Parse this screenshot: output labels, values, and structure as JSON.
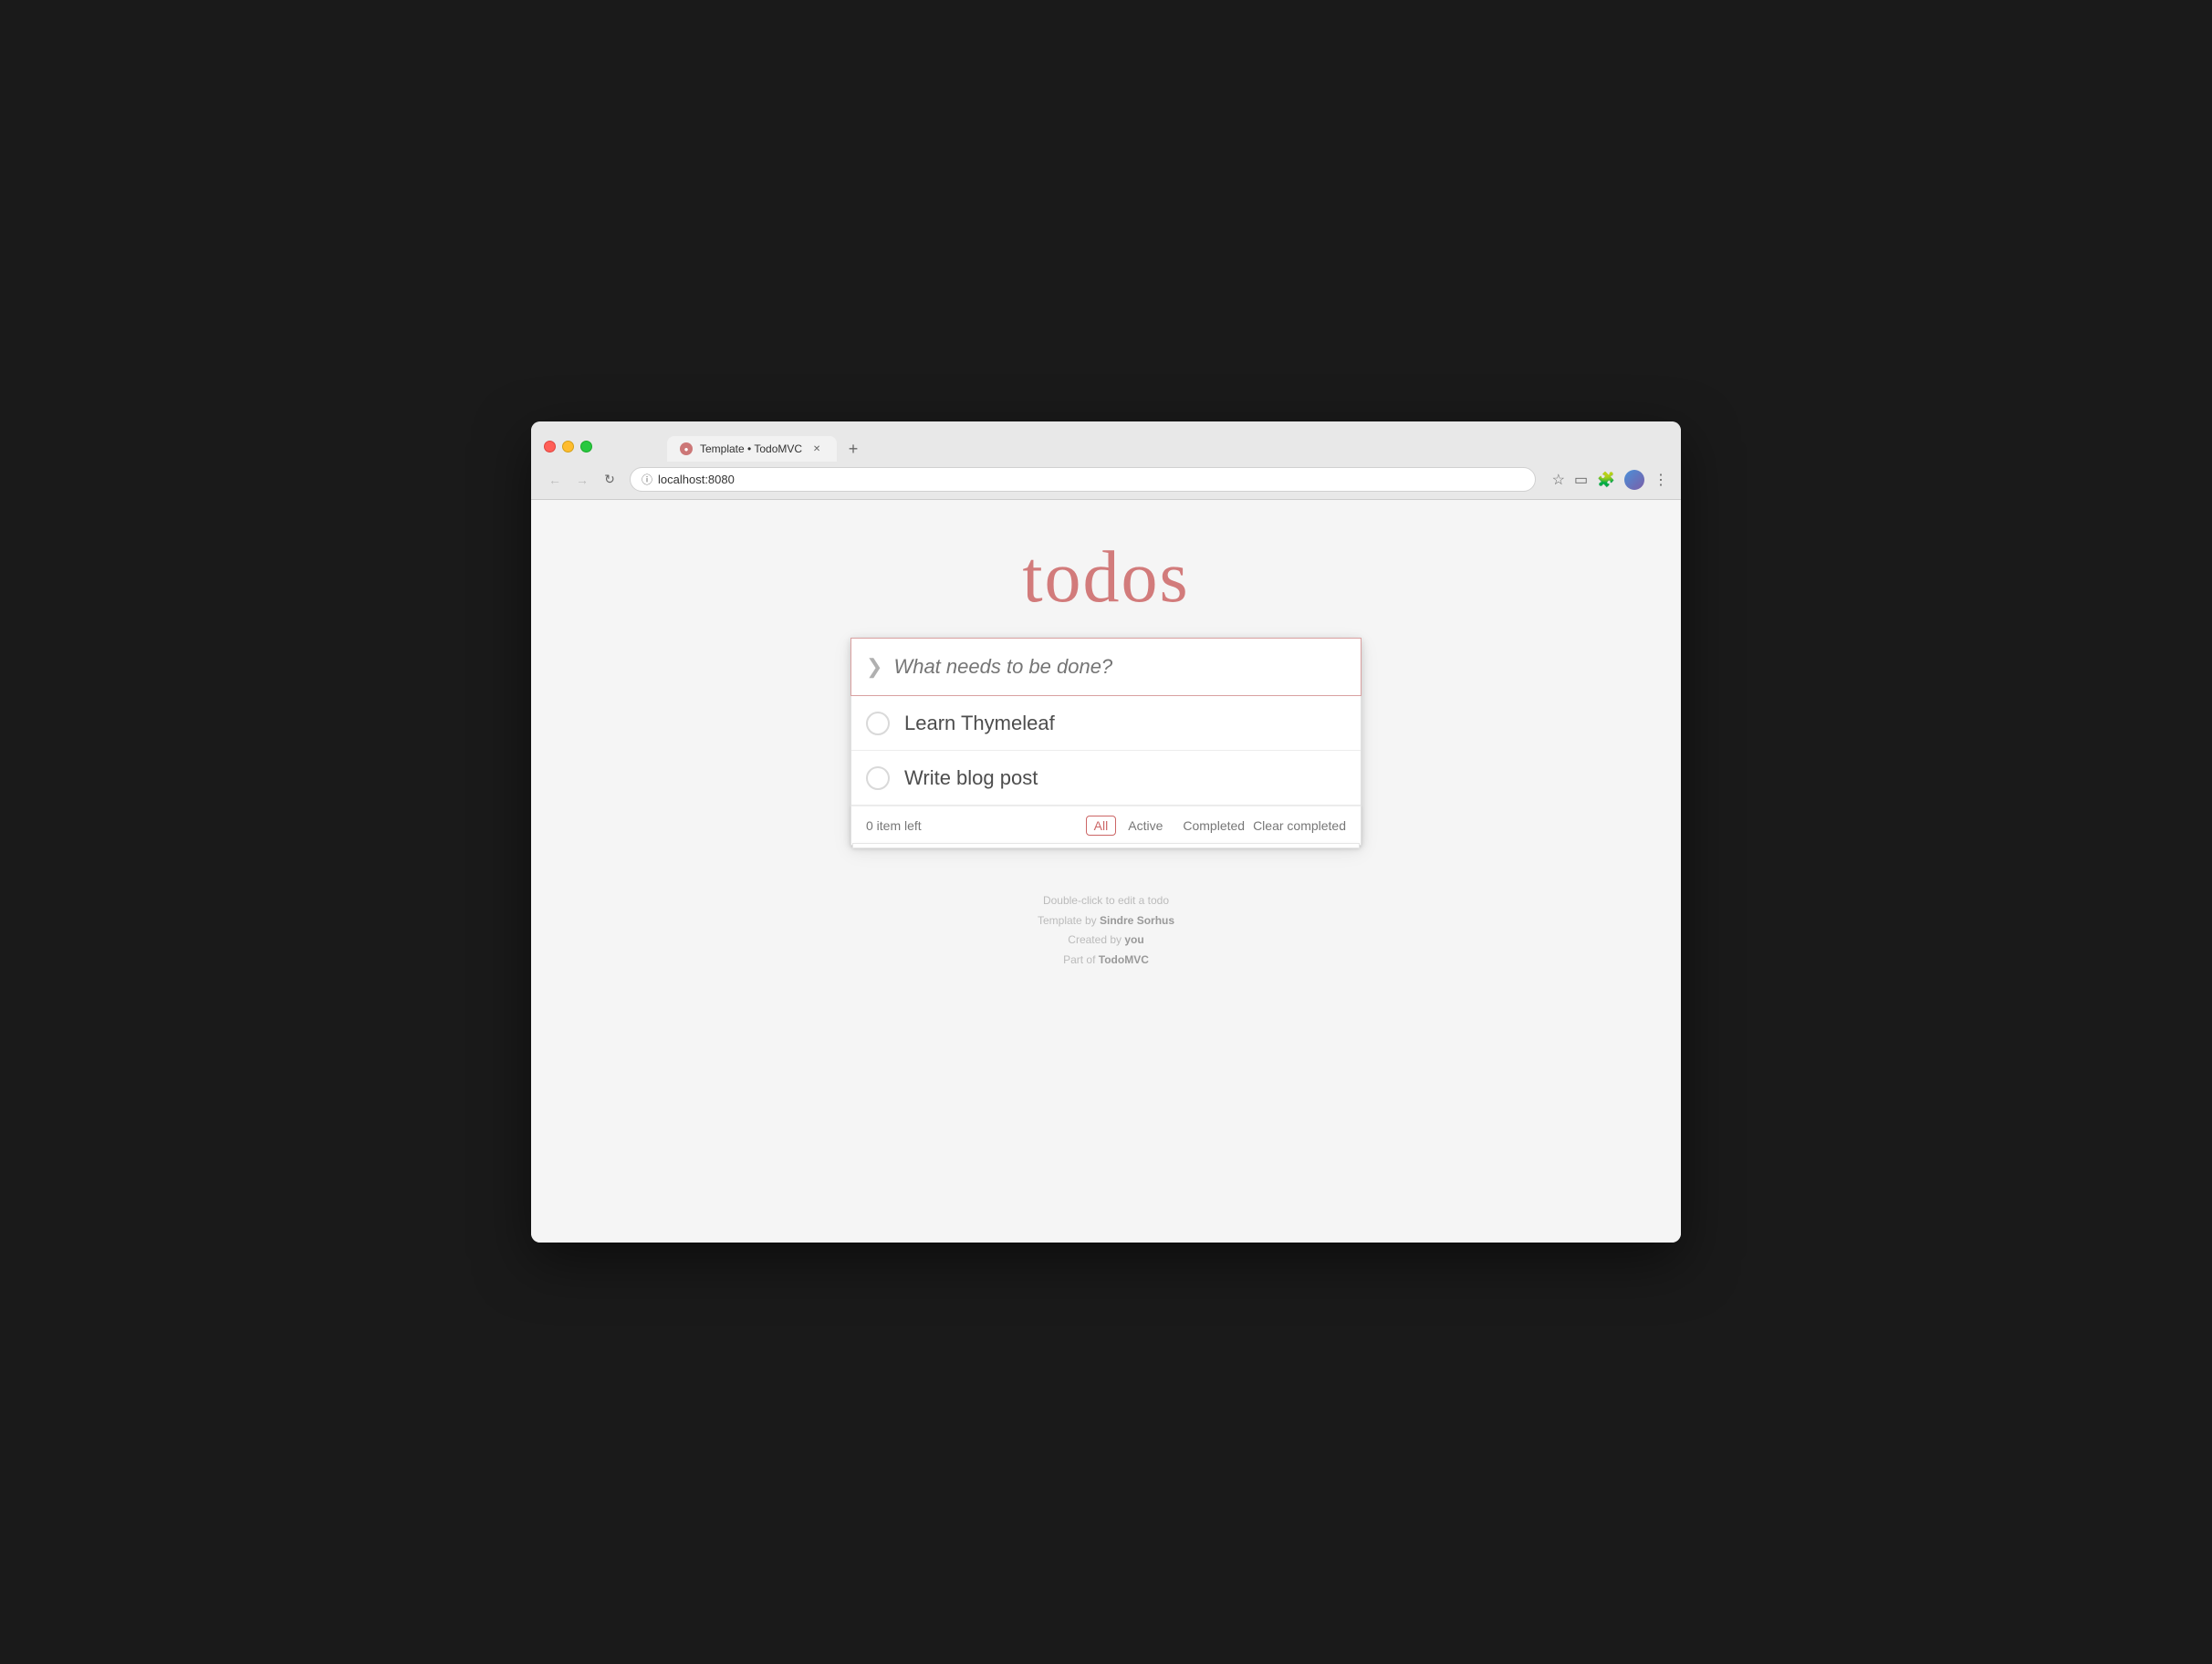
{
  "browser": {
    "tab_title": "Template • TodoMVC",
    "url": "localhost:8080",
    "back_disabled": true,
    "forward_disabled": true
  },
  "app": {
    "title": "todos",
    "input_placeholder": "What needs to be done?",
    "todos": [
      {
        "id": 1,
        "text": "Learn Thymeleaf",
        "completed": false
      },
      {
        "id": 2,
        "text": "Write blog post",
        "completed": false
      }
    ],
    "item_count_label": "0 item left",
    "filters": [
      {
        "label": "All",
        "active": true
      },
      {
        "label": "Active",
        "active": false
      },
      {
        "label": "Completed",
        "active": false
      }
    ],
    "clear_completed_label": "Clear completed"
  },
  "footer": {
    "hint": "Double-click to edit a todo",
    "template_by": "Template by ",
    "template_author": "Sindre Sorhus",
    "created_by": "Created by ",
    "created_author": "you",
    "part_of": "Part of ",
    "part_of_link": "TodoMVC"
  }
}
